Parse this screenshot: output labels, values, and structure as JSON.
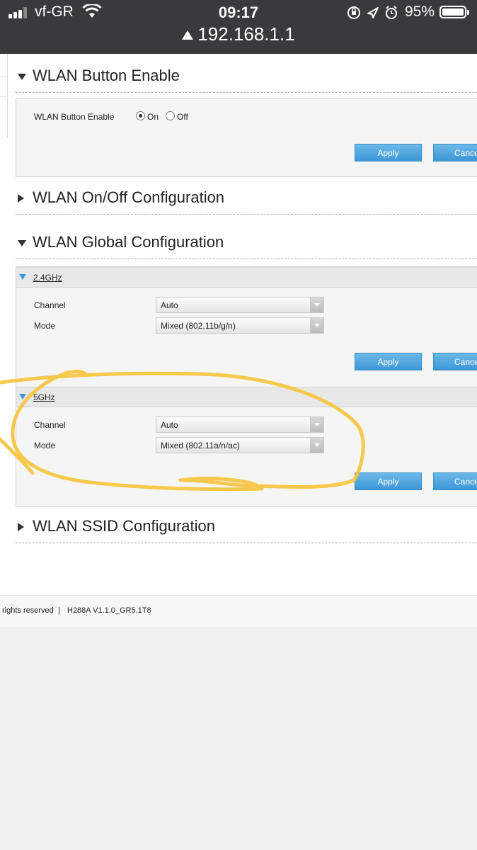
{
  "status_bar": {
    "carrier": "vf-GR",
    "time": "09:17",
    "battery": "95%",
    "battery_level": 0.95,
    "icons": [
      "signal-icon",
      "wifi-icon",
      "rotation-lock-icon",
      "location-arrow-icon",
      "alarm-icon",
      "battery-icon"
    ]
  },
  "address_bar": {
    "url": "192.168.1.1",
    "icon": "warning-icon"
  },
  "button_enable": {
    "title": "WLAN Button Enable",
    "field_label": "WLAN Button Enable",
    "on_label": "On",
    "off_label": "Off",
    "selected": "On",
    "apply_label": "Apply",
    "cancel_label": "Cance"
  },
  "onoff_config": {
    "title": "WLAN On/Off Configuration"
  },
  "global_config": {
    "title": "WLAN Global Configuration",
    "band_24": {
      "title": "2.4GHz",
      "channel_label": "Channel",
      "channel_value": "Auto",
      "mode_label": "Mode",
      "mode_value": "Mixed (802.11b/g/n)",
      "apply_label": "Apply",
      "cancel_label": "Cance"
    },
    "band_5": {
      "title": "5GHz",
      "channel_label": "Channel",
      "channel_value": "Auto",
      "mode_label": "Mode",
      "mode_value": "Mixed (802.11a/n/ac)",
      "apply_label": "Apply",
      "cancel_label": "Cance"
    }
  },
  "ssid_config": {
    "title": "WLAN SSID Configuration"
  },
  "footer": {
    "rights": "rights reserved",
    "separator": "|",
    "version": "H288A V1.1.0_GR5.1T8"
  },
  "colors": {
    "accent": "#3d97d6",
    "annotation": "#f5c542",
    "topbar": "#3a3a3c"
  }
}
